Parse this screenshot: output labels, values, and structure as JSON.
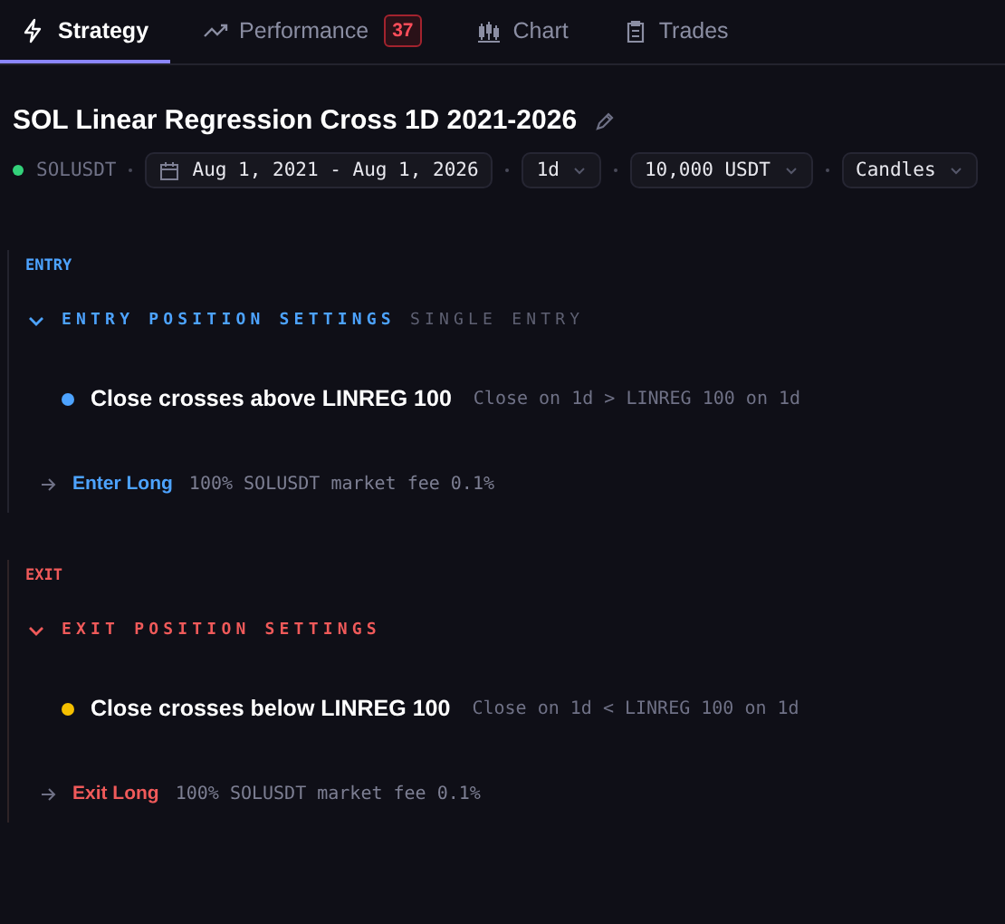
{
  "tabs": [
    {
      "label": "Strategy",
      "kind": "bolt",
      "selected": true
    },
    {
      "label": "Performance",
      "kind": "trend",
      "selected": false,
      "badge": "37"
    },
    {
      "label": "Chart",
      "kind": "candles",
      "selected": false
    },
    {
      "label": "Trades",
      "kind": "clipboard",
      "selected": false
    }
  ],
  "strategy": {
    "title": "SOL Linear Regression Cross 1D 2021-2026",
    "symbol": "SOLUSDT",
    "date_range": "Aug 1, 2021 - Aug 1, 2026",
    "timeframe": "1d",
    "capital": "10,000 USDT",
    "chart_type": "Candles"
  },
  "sections": [
    {
      "kind": "entry",
      "label": "ENTRY",
      "heading": "ENTRY POSITION SETTINGS",
      "subheading": "SINGLE ENTRY",
      "expanded": true,
      "condition": {
        "name": "Close crosses above LINREG 100",
        "formula": "Close on 1d > LINREG 100 on 1d",
        "color": "#4da3ff"
      },
      "action": {
        "name": "Enter Long",
        "details": "100% SOLUSDT market fee 0.1%"
      }
    },
    {
      "kind": "exit",
      "label": "EXIT",
      "heading": "EXIT POSITION SETTINGS",
      "expanded": true,
      "condition": {
        "name": "Close crosses below LINREG 100",
        "formula": "Close on 1d < LINREG 100 on 1d",
        "color": "#f5c000"
      },
      "action": {
        "name": "Exit Long",
        "details": "100% SOLUSDT market fee 0.1%"
      }
    }
  ]
}
